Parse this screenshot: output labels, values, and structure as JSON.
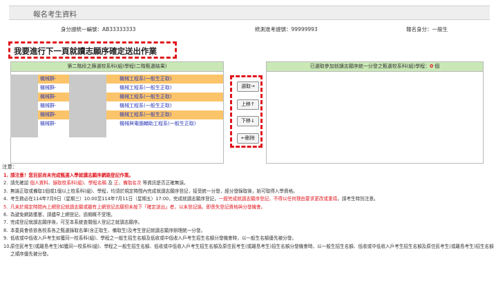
{
  "header": {
    "title": "報名考生資料"
  },
  "info": {
    "id_label": "身分證統一編號：",
    "id_value": "AB33333333",
    "exam_label": "統測准考證號：",
    "exam_value": "99999993",
    "identity_label": "報名身分：",
    "identity_value": "一般生"
  },
  "banner": {
    "text": "我要進行下一頁就讀志願序確定送出作業"
  },
  "left_list": {
    "header": "第二階段之篩選校系科(組)學程(二階甄選結果)",
    "items": [
      {
        "group": "機械群-",
        "dept": "機械工程系(一般生正取)",
        "highlight": true
      },
      {
        "group": "機械群-",
        "dept": "機械工程系(一般生正取)",
        "highlight": false
      },
      {
        "group": "機械群-",
        "dept": "機械工程系(一般生正取)",
        "highlight": true
      },
      {
        "group": "機械群-",
        "dept": "機械工程系(一般生正取)",
        "highlight": false
      },
      {
        "group": "機械群-",
        "dept": "機械工程系(一般生正取)",
        "highlight": true
      },
      {
        "group": "機械群-",
        "dept": "機械與電腦輔助工程系(一般生正取)",
        "highlight": false
      }
    ]
  },
  "right_list": {
    "header_prefix": "已選取參加就讀志願序統一分發之甄選校系科(組)學程：",
    "count": "0",
    "header_suffix": " 個"
  },
  "buttons": {
    "select": "選取→",
    "up": "上移↑",
    "down": "下移↓",
    "delete": "←刪除"
  },
  "notes": {
    "title": "注意：",
    "items": [
      {
        "num": "1.",
        "text": "請注意！您目前尚未完成甄選入學就讀志願序網路登記作業。"
      },
      {
        "num": "2.",
        "parts": [
          "請先確認 ",
          "個人資料",
          "、",
          "錄取校系科(組)",
          "、",
          "學程名稱",
          " 及 ",
          "正",
          "、",
          "備取名次",
          " 等資訊是否正確無誤。"
        ]
      },
      {
        "num": "3.",
        "text": "無論正取或備取1個或1個以上校系科(組)、學程，均須於規定時間內完成就讀志願序登記，接受統一分發，經分發錄取後，始可取得入學資格。"
      },
      {
        "num": "4.",
        "parts": [
          "考生務必在114年7月9日（星期三）10:00至114年7月11日（星期五）17:00，完成就讀志願序登記，",
          "一經完成就讀志願序登記，不得以任何理由要求更改或重填",
          "，請考生特別注意。"
        ]
      },
      {
        "num": "5.",
        "text": "凡未於規定時間內上網登記就讀志願或雖有上網登記志願但未按下「確定送出」者，以未登記論，即喪失登記資格與分發機會。"
      },
      {
        "num": "6.",
        "text": "為避免網路壅塞，請儘早上網登記，逾期概不受理。"
      },
      {
        "num": "7.",
        "text": "完成登記就讀志願序後，可至本系統查閱個人登記之就讀志願序。"
      },
      {
        "num": "8.",
        "text": "本委員會依依各校系各之甄選錄取名單(含正取生、備取生)及考生登記就讀志願序辦理統一分發。"
      },
      {
        "num": "9.",
        "text": "低收或中低收入戶考生如獲同一校系科(組)、學程之一般生招生名額及低收或中低收入戶考生招生名額分發機會時，以一般生名額優先被分發。"
      },
      {
        "num": "10.",
        "text": "原住民考生(或離島考生)如獲同一校系科(組)、學程之一般生招生名額、低收或中低收入戶考生招生名額及原住民考生(或離島考生)招生名額分發機會時，以一般生招生名額、低收或中低收入戶考生招生名額及原住民考生(或離島考生)招生名額之順序優先被分發。"
      }
    ]
  },
  "colors": {
    "accent_red": "#e0141c",
    "list_header_green": "#c9e8b6",
    "highlight_orange": "#fbc46a",
    "link_blue": "#2a39b7"
  }
}
